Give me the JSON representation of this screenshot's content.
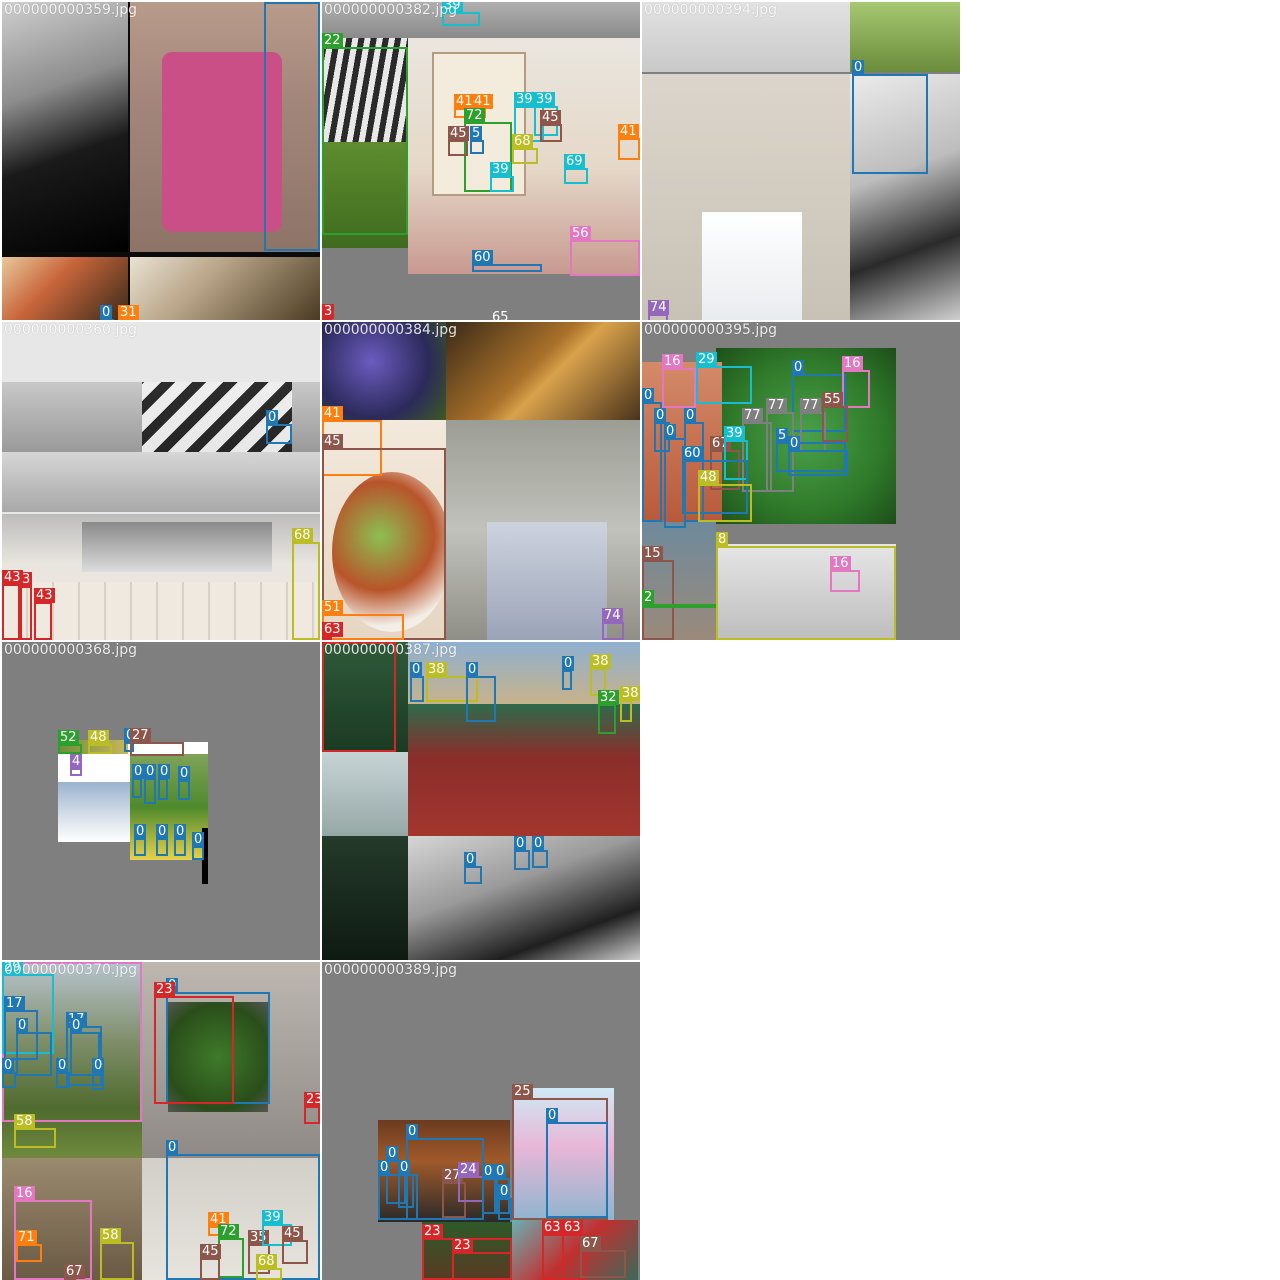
{
  "palette": {
    "0": "#1f77b4",
    "2": "#2ca02c",
    "3": "#d62728",
    "4": "#9467bd",
    "8": "#bcbd22",
    "15": "#8c564b",
    "16": "#e377c2",
    "17": "#1f77b4",
    "22": "#2ca02c",
    "23": "#d62728",
    "24": "#9467bd",
    "25": "#8c564b",
    "27": "#8c564b",
    "29": "#17becf",
    "31": "#ff7f0e",
    "32": "#2ca02c",
    "35": "#8c564b",
    "38": "#bcbd22",
    "39": "#17becf",
    "41": "#ff7f0e",
    "43": "#d62728",
    "45": "#8c564b",
    "48": "#bcbd22",
    "51": "#ff7f0e",
    "52": "#2ca02c",
    "55": "#8c564b",
    "56": "#e377c2",
    "58": "#bcbd22",
    "60": "#1f77b4",
    "63": "#d62728",
    "65": "#7f7f7f",
    "67": "#8c564b",
    "68": "#bcbd22",
    "69": "#17becf",
    "71": "#ff7f0e",
    "72": "#2ca02c",
    "74": "#9467bd",
    "77": "#7f7f7f"
  },
  "tiles": [
    {
      "filename": "000000000359.jpg",
      "boxes": [
        {
          "label": "0"
        },
        {
          "label": "0"
        },
        {
          "label": "31"
        }
      ]
    },
    {
      "filename": "000000000382.jpg",
      "boxes": [
        {
          "label": "39"
        },
        {
          "label": "22"
        },
        {
          "label": "41"
        },
        {
          "label": "41"
        },
        {
          "label": "72"
        },
        {
          "label": "45"
        },
        {
          "label": "5"
        },
        {
          "label": "39"
        },
        {
          "label": "39"
        },
        {
          "label": "45"
        },
        {
          "label": "68"
        },
        {
          "label": "41"
        },
        {
          "label": "39"
        },
        {
          "label": "69"
        },
        {
          "label": "56"
        },
        {
          "label": "60"
        },
        {
          "label": "3"
        },
        {
          "label": "65"
        }
      ]
    },
    {
      "filename": "000000000394.jpg",
      "boxes": [
        {
          "label": "0"
        },
        {
          "label": "74"
        }
      ]
    },
    {
      "filename": "000000000360.jpg",
      "boxes": [
        {
          "label": "0"
        },
        {
          "label": "68"
        },
        {
          "label": "43"
        },
        {
          "label": "3"
        },
        {
          "label": "43"
        }
      ]
    },
    {
      "filename": "000000000384.jpg",
      "boxes": [
        {
          "label": "41"
        },
        {
          "label": "45"
        },
        {
          "label": "51"
        },
        {
          "label": "63"
        },
        {
          "label": "74"
        }
      ]
    },
    {
      "filename": "000000000395.jpg",
      "boxes": [
        {
          "label": "16"
        },
        {
          "label": "29"
        },
        {
          "label": "0"
        },
        {
          "label": "16"
        },
        {
          "label": "0"
        },
        {
          "label": "0"
        },
        {
          "label": "77"
        },
        {
          "label": "77"
        },
        {
          "label": "77"
        },
        {
          "label": "55"
        },
        {
          "label": "0"
        },
        {
          "label": "0"
        },
        {
          "label": "67"
        },
        {
          "label": "39"
        },
        {
          "label": "5"
        },
        {
          "label": "0"
        },
        {
          "label": "60"
        },
        {
          "label": "48"
        },
        {
          "label": "15"
        },
        {
          "label": "8"
        },
        {
          "label": "16"
        },
        {
          "label": "2"
        }
      ]
    },
    {
      "filename": "000000000368.jpg",
      "boxes": [
        {
          "label": "52"
        },
        {
          "label": "48"
        },
        {
          "label": "0"
        },
        {
          "label": "27"
        },
        {
          "label": "4"
        },
        {
          "label": "0"
        },
        {
          "label": "0"
        },
        {
          "label": "0"
        },
        {
          "label": "0"
        },
        {
          "label": "0"
        },
        {
          "label": "0"
        },
        {
          "label": "0"
        },
        {
          "label": "0"
        }
      ]
    },
    {
      "filename": "000000000387.jpg",
      "boxes": [
        {
          "label": "38"
        },
        {
          "label": "0"
        },
        {
          "label": "0"
        },
        {
          "label": "0"
        },
        {
          "label": "38"
        },
        {
          "label": "32"
        },
        {
          "label": "38"
        },
        {
          "label": "0"
        },
        {
          "label": "0"
        },
        {
          "label": "0"
        }
      ]
    },
    {
      "filename": "000000000370.jpg",
      "boxes": [
        {
          "label": "16"
        },
        {
          "label": "29"
        },
        {
          "label": "0"
        },
        {
          "label": "17"
        },
        {
          "label": "17"
        },
        {
          "label": "0"
        },
        {
          "label": "0"
        },
        {
          "label": "0"
        },
        {
          "label": "0"
        },
        {
          "label": "23"
        },
        {
          "label": "0"
        },
        {
          "label": "23"
        },
        {
          "label": "58"
        },
        {
          "label": "0"
        },
        {
          "label": "16"
        },
        {
          "label": "71"
        },
        {
          "label": "58"
        },
        {
          "label": "67"
        },
        {
          "label": "41"
        },
        {
          "label": "72"
        },
        {
          "label": "35"
        },
        {
          "label": "39"
        },
        {
          "label": "45"
        },
        {
          "label": "45"
        },
        {
          "label": "68"
        }
      ]
    },
    {
      "filename": "000000000389.jpg",
      "boxes": [
        {
          "label": "25"
        },
        {
          "label": "0"
        },
        {
          "label": "0"
        },
        {
          "label": "0"
        },
        {
          "label": "0"
        },
        {
          "label": "0"
        },
        {
          "label": "27"
        },
        {
          "label": "24"
        },
        {
          "label": "0"
        },
        {
          "label": "0"
        },
        {
          "label": "0"
        },
        {
          "label": "23"
        },
        {
          "label": "23"
        },
        {
          "label": "63"
        },
        {
          "label": "63"
        },
        {
          "label": "67"
        }
      ]
    }
  ]
}
